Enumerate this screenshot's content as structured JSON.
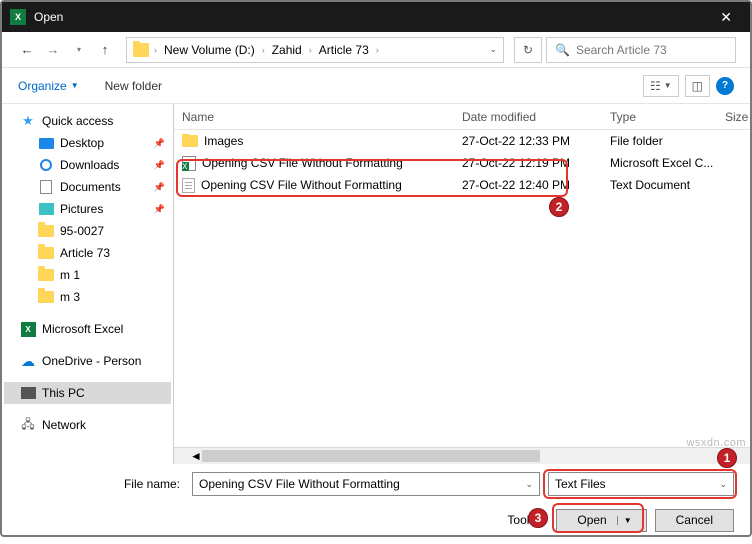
{
  "titlebar": {
    "title": "Open"
  },
  "breadcrumbs": {
    "loc1": "New Volume (D:)",
    "loc2": "Zahid",
    "loc3": "Article 73"
  },
  "search": {
    "placeholder": "Search Article 73"
  },
  "toolbar": {
    "organize": "Organize",
    "newfolder": "New folder"
  },
  "sidebar": {
    "quick": "Quick access",
    "desktop": "Desktop",
    "downloads": "Downloads",
    "documents": "Documents",
    "pictures": "Pictures",
    "f1": "95-0027",
    "f2": "Article 73",
    "f3": "m 1",
    "f4": "m 3",
    "excel": "Microsoft Excel",
    "onedrive": "OneDrive - Person",
    "thispc": "This PC",
    "network": "Network"
  },
  "headers": {
    "name": "Name",
    "date": "Date modified",
    "type": "Type",
    "size": "Size"
  },
  "files": {
    "r0": {
      "name": "Images",
      "date": "27-Oct-22 12:33 PM",
      "type": "File folder"
    },
    "r1": {
      "name": "Opening CSV File Without Formatting",
      "date": "27-Oct-22 12:19 PM",
      "type": "Microsoft Excel C..."
    },
    "r2": {
      "name": "Opening CSV File Without Formatting",
      "date": "27-Oct-22 12:40 PM",
      "type": "Text Document"
    }
  },
  "filename": {
    "label": "File name:",
    "value": "Opening CSV File Without Formatting",
    "filter": "Text Files"
  },
  "buttons": {
    "tools": "Tools",
    "open": "Open",
    "cancel": "Cancel"
  },
  "badges": {
    "b1": "1",
    "b2": "2",
    "b3": "3"
  },
  "watermark": "wsxdn.com"
}
